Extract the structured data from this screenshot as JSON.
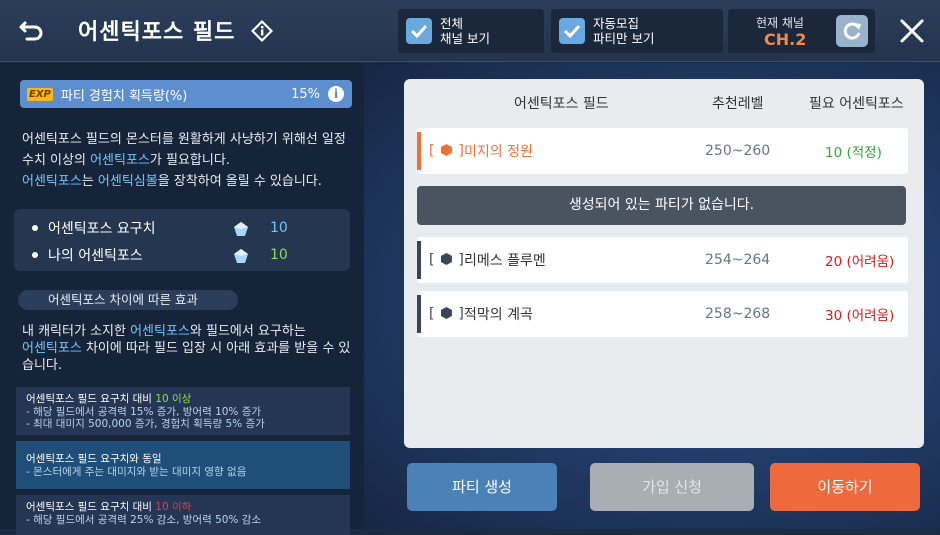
{
  "header": {
    "title": "어센틱포스 필드"
  },
  "toggles": [
    {
      "label": "전체\n채널 보기",
      "checked": true
    },
    {
      "label": "자동모집\n파티만 보기",
      "checked": true
    }
  ],
  "channel": {
    "label": "현재 채널",
    "value": "CH.2"
  },
  "exp_bar": {
    "badge": "EXP",
    "label": "파티 경험치 획득량(%)",
    "value": "15%",
    "info": "i"
  },
  "description": {
    "p1": "어센틱포스 필드의 몬스터를 원활하게 사냥하기 위해선 일정 수치 이상의 ",
    "p1_hl": "어센틱포스",
    "p1_end": "가 필요합니다.",
    "p2_hl1": "어센틱포스",
    "p2_mid": "는 ",
    "p2_hl2": "어센틱심볼",
    "p2_end": "을 장착하여 올릴 수 있습니다."
  },
  "requirements": [
    {
      "label": "어센틱포스 요구치",
      "value": "10",
      "color": "#6fc6ff"
    },
    {
      "label": "나의 어센틱포스",
      "value": "10",
      "color": "#8be04e"
    }
  ],
  "effects": {
    "header": "어센틱포스 차이에 따른 효과",
    "desc_a": "내 캐릭터가 소지한 ",
    "desc_hl1": "어센틱포스",
    "desc_b": "와 필드에서 요구하는",
    "desc_hl2": "어센틱포스",
    "desc_c": " 차이에 따라 필드 입장 시 아래 효과를 받을 수 있습니다.",
    "items": [
      {
        "lead": "어센틱포스 필드 요구치 대비 ",
        "val": "10 이상",
        "val_color": "#8be04e",
        "lines": [
          "- 해당 필드에서 공격력 15% 증가, 방어력 10% 증가",
          "- 최대 대미지 500,000 증가, 경험치 획득량 5% 증가"
        ]
      },
      {
        "lead": "어센틱포스 필드 요구치와 동일",
        "val": "",
        "val_color": "#fff",
        "lines": [
          "- 몬스터에게 주는 대미지와 받는 대미지 영향 없음"
        ]
      },
      {
        "lead": "어센틱포스 필드 요구치 대비 ",
        "val": "10 이하",
        "val_color": "#e0404a",
        "lines": [
          "- 해당 필드에서 공격력 25% 감소, 방어력 50% 감소"
        ]
      }
    ]
  },
  "table": {
    "headers": [
      "어센틱포스 필드",
      "추천레벨",
      "필요 어센틱포스"
    ],
    "rows": [
      {
        "bracket_l": "[",
        "bracket_r": "]",
        "name": "미지의 정원",
        "level": "250~260",
        "req": "10 (적정)",
        "req_color": "#2fa52f",
        "accent": "#f0703a",
        "selected": true
      },
      {
        "bracket_l": "[",
        "bracket_r": "]",
        "name": "리메스 플루멘",
        "level": "254~264",
        "req": "20 (어려움)",
        "req_color": "#d61c1c",
        "accent": "#3a4658",
        "selected": false
      },
      {
        "bracket_l": "[",
        "bracket_r": "]",
        "name": "적막의 계곡",
        "level": "258~268",
        "req": "30 (어려움)",
        "req_color": "#d61c1c",
        "accent": "#3a4658",
        "selected": false
      }
    ],
    "no_party": "생성되어 있는 파티가 없습니다."
  },
  "buttons": {
    "create": "파티 생성",
    "join": "가입 신청",
    "move": "이동하기"
  }
}
